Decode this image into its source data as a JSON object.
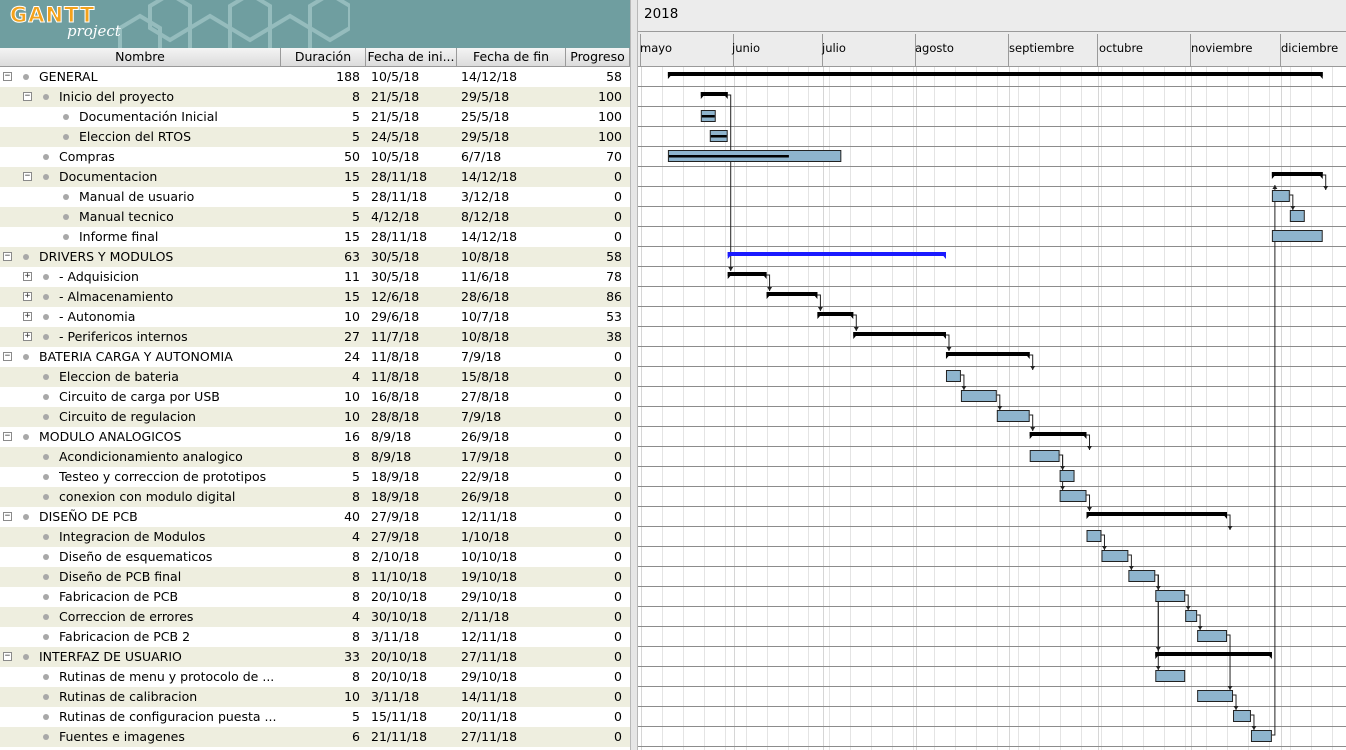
{
  "app": {
    "logo_main": "GANTT",
    "logo_sub": "project"
  },
  "columns": {
    "name": "Nombre",
    "duration": "Duración",
    "start": "Fecha de ini...",
    "end": "Fecha de fin",
    "progress": "Progreso"
  },
  "timeline": {
    "year": "2018",
    "months": [
      "mayo",
      "junio",
      "julio",
      "agosto",
      "septiembre",
      "octubre",
      "noviembre",
      "diciembre"
    ]
  },
  "colors": {
    "summary_bar": "#000000",
    "task_bar": "#8eb4cd",
    "critical_bar": "#1a1aff",
    "logo_bg": "#6f9ea0",
    "row_alt": "#eeeedf"
  },
  "tasks": [
    {
      "name": "GENERAL",
      "duration": "188",
      "start": "10/5/18",
      "end": "14/12/18",
      "progress": "58",
      "level": 0,
      "toggle": "minus",
      "type": "summary",
      "from": "2018-05-10",
      "to": "2018-12-14"
    },
    {
      "name": "Inicio del proyecto",
      "duration": "8",
      "start": "21/5/18",
      "end": "29/5/18",
      "progress": "100",
      "level": 1,
      "toggle": "minus",
      "type": "summary",
      "from": "2018-05-21",
      "to": "2018-05-29"
    },
    {
      "name": "Documentación Inicial",
      "duration": "5",
      "start": "21/5/18",
      "end": "25/5/18",
      "progress": "100",
      "level": 2,
      "toggle": "",
      "type": "task",
      "from": "2018-05-21",
      "to": "2018-05-25"
    },
    {
      "name": "Eleccion del RTOS",
      "duration": "5",
      "start": "24/5/18",
      "end": "29/5/18",
      "progress": "100",
      "level": 2,
      "toggle": "",
      "type": "task",
      "from": "2018-05-24",
      "to": "2018-05-29"
    },
    {
      "name": "Compras",
      "duration": "50",
      "start": "10/5/18",
      "end": "6/7/18",
      "progress": "70",
      "level": 1,
      "toggle": "",
      "type": "task",
      "from": "2018-05-10",
      "to": "2018-07-06"
    },
    {
      "name": "Documentacion",
      "duration": "15",
      "start": "28/11/18",
      "end": "14/12/18",
      "progress": "0",
      "level": 1,
      "toggle": "minus",
      "type": "summary",
      "from": "2018-11-28",
      "to": "2018-12-14"
    },
    {
      "name": "Manual de usuario",
      "duration": "5",
      "start": "28/11/18",
      "end": "3/12/18",
      "progress": "0",
      "level": 2,
      "toggle": "",
      "type": "task",
      "from": "2018-11-28",
      "to": "2018-12-03"
    },
    {
      "name": "Manual tecnico",
      "duration": "5",
      "start": "4/12/18",
      "end": "8/12/18",
      "progress": "0",
      "level": 2,
      "toggle": "",
      "type": "task",
      "from": "2018-12-04",
      "to": "2018-12-08"
    },
    {
      "name": "Informe final",
      "duration": "15",
      "start": "28/11/18",
      "end": "14/12/18",
      "progress": "0",
      "level": 2,
      "toggle": "",
      "type": "task",
      "from": "2018-11-28",
      "to": "2018-12-14"
    },
    {
      "name": "DRIVERS Y MODULOS",
      "duration": "63",
      "start": "30/5/18",
      "end": "10/8/18",
      "progress": "58",
      "level": 0,
      "toggle": "minus",
      "type": "critical",
      "from": "2018-05-30",
      "to": "2018-08-10"
    },
    {
      "name": "- Adquisicion",
      "duration": "11",
      "start": "30/5/18",
      "end": "11/6/18",
      "progress": "78",
      "level": 1,
      "toggle": "plus",
      "type": "summary",
      "from": "2018-05-30",
      "to": "2018-06-11"
    },
    {
      "name": "- Almacenamiento",
      "duration": "15",
      "start": "12/6/18",
      "end": "28/6/18",
      "progress": "86",
      "level": 1,
      "toggle": "plus",
      "type": "summary",
      "from": "2018-06-12",
      "to": "2018-06-28"
    },
    {
      "name": "- Autonomia",
      "duration": "10",
      "start": "29/6/18",
      "end": "10/7/18",
      "progress": "53",
      "level": 1,
      "toggle": "plus",
      "type": "summary",
      "from": "2018-06-29",
      "to": "2018-07-10"
    },
    {
      "name": "- Perifericos internos",
      "duration": "27",
      "start": "11/7/18",
      "end": "10/8/18",
      "progress": "38",
      "level": 1,
      "toggle": "plus",
      "type": "summary",
      "from": "2018-07-11",
      "to": "2018-08-10"
    },
    {
      "name": "BATERIA CARGA Y AUTONOMIA",
      "duration": "24",
      "start": "11/8/18",
      "end": "7/9/18",
      "progress": "0",
      "level": 0,
      "toggle": "minus",
      "type": "summary",
      "from": "2018-08-11",
      "to": "2018-09-07"
    },
    {
      "name": "Eleccion de bateria",
      "duration": "4",
      "start": "11/8/18",
      "end": "15/8/18",
      "progress": "0",
      "level": 1,
      "toggle": "",
      "type": "task",
      "from": "2018-08-11",
      "to": "2018-08-15"
    },
    {
      "name": "Circuito de carga por USB",
      "duration": "10",
      "start": "16/8/18",
      "end": "27/8/18",
      "progress": "0",
      "level": 1,
      "toggle": "",
      "type": "task",
      "from": "2018-08-16",
      "to": "2018-08-27"
    },
    {
      "name": "Circuito de regulacion",
      "duration": "10",
      "start": "28/8/18",
      "end": "7/9/18",
      "progress": "0",
      "level": 1,
      "toggle": "",
      "type": "task",
      "from": "2018-08-28",
      "to": "2018-09-07"
    },
    {
      "name": "MODULO ANALOGICOS",
      "duration": "16",
      "start": "8/9/18",
      "end": "26/9/18",
      "progress": "0",
      "level": 0,
      "toggle": "minus",
      "type": "summary",
      "from": "2018-09-08",
      "to": "2018-09-26"
    },
    {
      "name": "Acondicionamiento analogico",
      "duration": "8",
      "start": "8/9/18",
      "end": "17/9/18",
      "progress": "0",
      "level": 1,
      "toggle": "",
      "type": "task",
      "from": "2018-09-08",
      "to": "2018-09-17"
    },
    {
      "name": "Testeo y correccion de prototipos",
      "duration": "5",
      "start": "18/9/18",
      "end": "22/9/18",
      "progress": "0",
      "level": 1,
      "toggle": "",
      "type": "task",
      "from": "2018-09-18",
      "to": "2018-09-22"
    },
    {
      "name": "conexion con modulo digital",
      "duration": "8",
      "start": "18/9/18",
      "end": "26/9/18",
      "progress": "0",
      "level": 1,
      "toggle": "",
      "type": "task",
      "from": "2018-09-18",
      "to": "2018-09-26"
    },
    {
      "name": "DISEÑO DE PCB",
      "duration": "40",
      "start": "27/9/18",
      "end": "12/11/18",
      "progress": "0",
      "level": 0,
      "toggle": "minus",
      "type": "summary",
      "from": "2018-09-27",
      "to": "2018-11-12"
    },
    {
      "name": "Integracion de Modulos",
      "duration": "4",
      "start": "27/9/18",
      "end": "1/10/18",
      "progress": "0",
      "level": 1,
      "toggle": "",
      "type": "task",
      "from": "2018-09-27",
      "to": "2018-10-01"
    },
    {
      "name": "Diseño de esquematicos",
      "duration": "8",
      "start": "2/10/18",
      "end": "10/10/18",
      "progress": "0",
      "level": 1,
      "toggle": "",
      "type": "task",
      "from": "2018-10-02",
      "to": "2018-10-10"
    },
    {
      "name": "Diseño de PCB final",
      "duration": "8",
      "start": "11/10/18",
      "end": "19/10/18",
      "progress": "0",
      "level": 1,
      "toggle": "",
      "type": "task",
      "from": "2018-10-11",
      "to": "2018-10-19"
    },
    {
      "name": "Fabricacion de PCB",
      "duration": "8",
      "start": "20/10/18",
      "end": "29/10/18",
      "progress": "0",
      "level": 1,
      "toggle": "",
      "type": "task",
      "from": "2018-10-20",
      "to": "2018-10-29"
    },
    {
      "name": "Correccion de errores",
      "duration": "4",
      "start": "30/10/18",
      "end": "2/11/18",
      "progress": "0",
      "level": 1,
      "toggle": "",
      "type": "task",
      "from": "2018-10-30",
      "to": "2018-11-02"
    },
    {
      "name": "Fabricacion de PCB 2",
      "duration": "8",
      "start": "3/11/18",
      "end": "12/11/18",
      "progress": "0",
      "level": 1,
      "toggle": "",
      "type": "task",
      "from": "2018-11-03",
      "to": "2018-11-12"
    },
    {
      "name": "INTERFAZ DE USUARIO",
      "duration": "33",
      "start": "20/10/18",
      "end": "27/11/18",
      "progress": "0",
      "level": 0,
      "toggle": "minus",
      "type": "summary",
      "from": "2018-10-20",
      "to": "2018-11-27"
    },
    {
      "name": "Rutinas de menu y protocolo de ...",
      "duration": "8",
      "start": "20/10/18",
      "end": "29/10/18",
      "progress": "0",
      "level": 1,
      "toggle": "",
      "type": "task",
      "from": "2018-10-20",
      "to": "2018-10-29"
    },
    {
      "name": "Rutinas de calibracion",
      "duration": "10",
      "start": "3/11/18",
      "end": "14/11/18",
      "progress": "0",
      "level": 1,
      "toggle": "",
      "type": "task",
      "from": "2018-11-03",
      "to": "2018-11-14"
    },
    {
      "name": "Rutinas de configuracion puesta ...",
      "duration": "5",
      "start": "15/11/18",
      "end": "20/11/18",
      "progress": "0",
      "level": 1,
      "toggle": "",
      "type": "task",
      "from": "2018-11-15",
      "to": "2018-11-20"
    },
    {
      "name": "Fuentes e imagenes",
      "duration": "6",
      "start": "21/11/18",
      "end": "27/11/18",
      "progress": "0",
      "level": 1,
      "toggle": "",
      "type": "task",
      "from": "2018-11-21",
      "to": "2018-11-27"
    }
  ],
  "dependencies": [
    [
      1,
      10
    ],
    [
      10,
      11
    ],
    [
      11,
      12
    ],
    [
      12,
      13
    ],
    [
      13,
      14
    ],
    [
      14,
      15
    ],
    [
      15,
      16
    ],
    [
      16,
      17
    ],
    [
      17,
      18
    ],
    [
      18,
      19
    ],
    [
      19,
      20
    ],
    [
      19,
      21
    ],
    [
      21,
      22
    ],
    [
      22,
      23
    ],
    [
      23,
      24
    ],
    [
      24,
      25
    ],
    [
      25,
      26
    ],
    [
      26,
      27
    ],
    [
      27,
      28
    ],
    [
      25,
      29
    ],
    [
      25,
      30
    ],
    [
      28,
      31
    ],
    [
      31,
      32
    ],
    [
      32,
      33
    ],
    [
      33,
      5
    ],
    [
      5,
      6
    ],
    [
      6,
      7
    ]
  ]
}
